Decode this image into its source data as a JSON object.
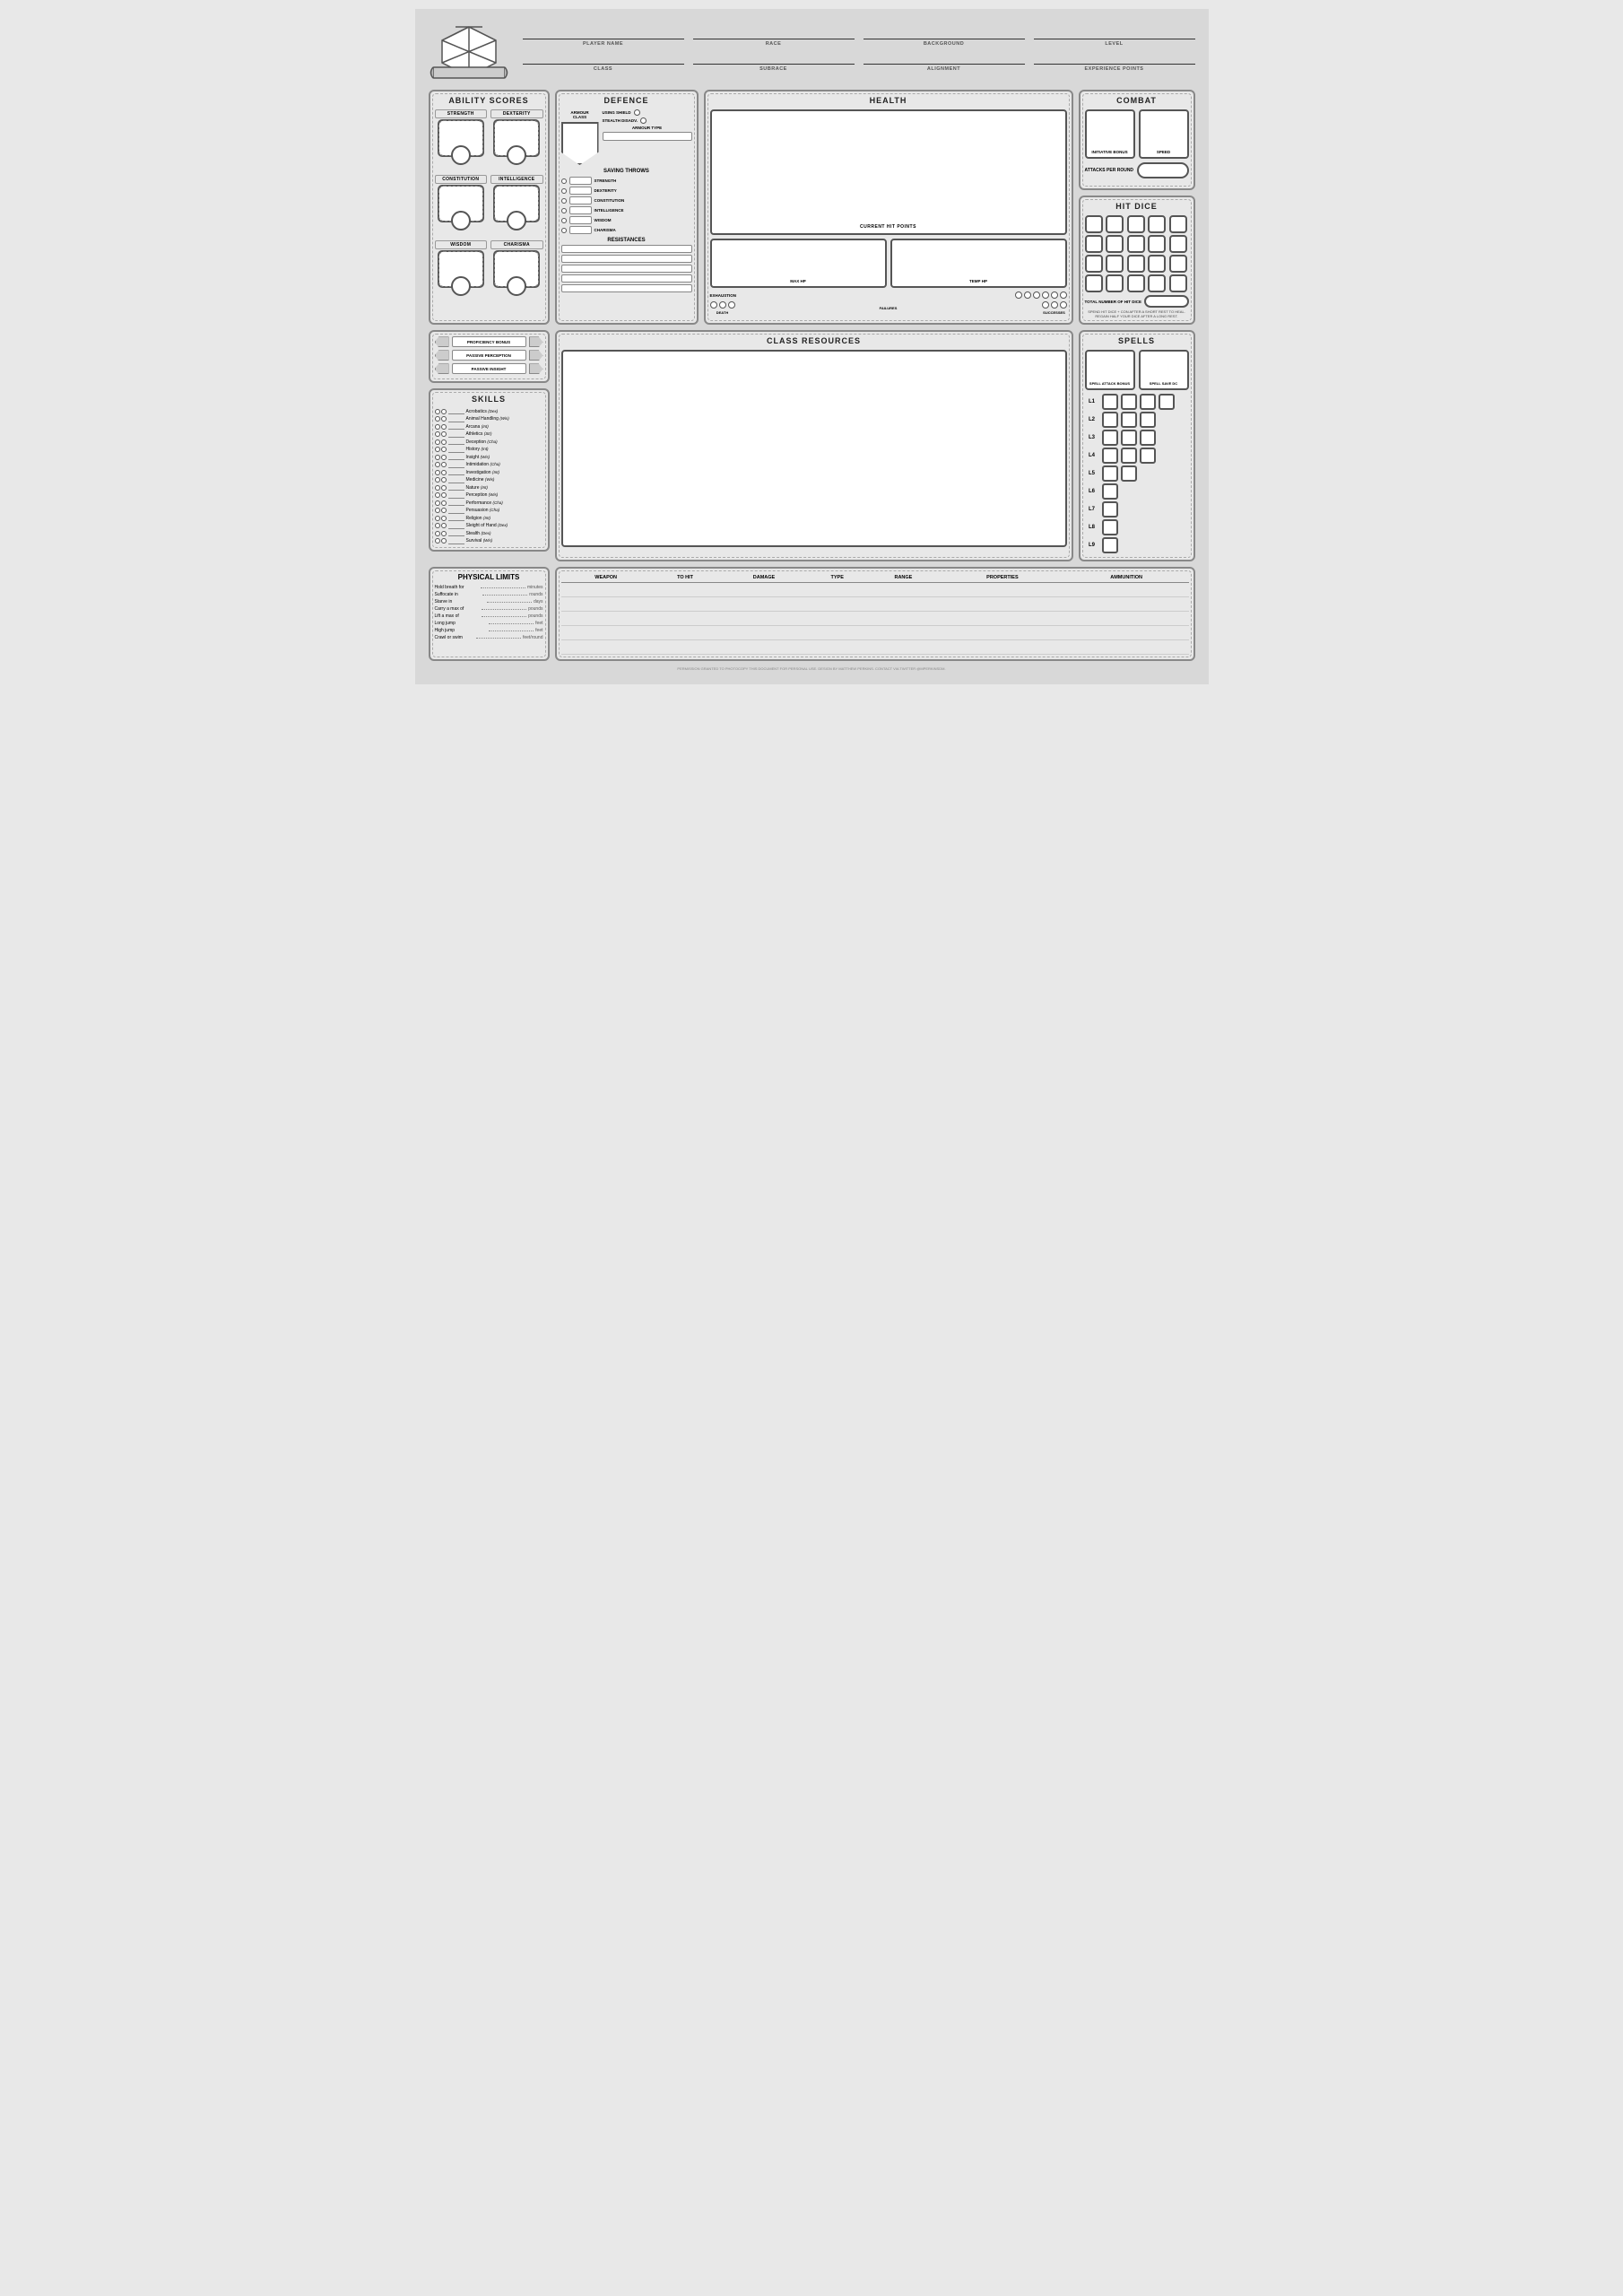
{
  "header": {
    "player_name_label": "PLAYER NAME",
    "race_label": "RACE",
    "background_label": "BACKGROUND",
    "level_label": "LEVEL",
    "class_label": "CLASS",
    "subrace_label": "SUBRACE",
    "alignment_label": "ALIGNMENT",
    "experience_label": "EXPERIENCE POINTS"
  },
  "ability_scores": {
    "title": "ABILITY SCORES",
    "scores": [
      {
        "label": "STRENGTH"
      },
      {
        "label": "DEXTERITY"
      },
      {
        "label": "CONSTITUTION"
      },
      {
        "label": "INTELLIGENCE"
      },
      {
        "label": "WISDOM"
      },
      {
        "label": "CHARISMA"
      }
    ]
  },
  "defence": {
    "title": "DEFENCE",
    "armour_class_label": "ARMOUR CLASS",
    "using_shield_label": "USING SHIELD",
    "stealth_disadv_label": "STEALTH DISADV.",
    "armour_type_label": "ARMOUR TYPE",
    "saving_throws_title": "SAVING THROWS",
    "saves": [
      {
        "label": "STRENGTH"
      },
      {
        "label": "DEXTERITY"
      },
      {
        "label": "CONSTITUTION"
      },
      {
        "label": "INTELLIGENCE"
      },
      {
        "label": "WISDOM"
      },
      {
        "label": "CHARISMA"
      }
    ],
    "resistances_title": "RESISTANCES"
  },
  "health": {
    "title": "HEALTH",
    "current_hp_label": "CURRENT HIT POINTS",
    "max_hp_label": "MAX HP",
    "temp_hp_label": "TEMP HP",
    "exhaustion_label": "EXHAUSTION",
    "death_label": "DEATH",
    "failures_label": "FAILURES",
    "successes_label": "SUCCESSES"
  },
  "combat": {
    "title": "COMBAT",
    "initiative_label": "INITIATIVE BONUS",
    "speed_label": "SPEED",
    "attacks_label": "ATTACKS PER ROUND"
  },
  "hit_dice": {
    "title": "HIT DICE",
    "total_label": "TOTAL NUMBER OF HIT DICE",
    "note": "SPEND HIT DICE + CON AFTER A SHORT REST TO HEAL. REGAIN HALF YOUR DICE AFTER A LONG REST."
  },
  "bonuses": {
    "proficiency_label": "PROFICIENCY BONUS",
    "perception_label": "PASSIVE PERCEPTION",
    "insight_label": "PASSIVE INSIGHT"
  },
  "skills": {
    "title": "SKILLS",
    "list": [
      {
        "name": "Acrobatics",
        "stat": "Dex"
      },
      {
        "name": "Animal Handling",
        "stat": "Wis"
      },
      {
        "name": "Arcana",
        "stat": "Int"
      },
      {
        "name": "Athletics",
        "stat": "Str"
      },
      {
        "name": "Deception",
        "stat": "Cha"
      },
      {
        "name": "History",
        "stat": "Int"
      },
      {
        "name": "Insight",
        "stat": "Wis"
      },
      {
        "name": "Intimidation",
        "stat": "Cha"
      },
      {
        "name": "Investigation",
        "stat": "Int"
      },
      {
        "name": "Medicine",
        "stat": "Wis"
      },
      {
        "name": "Nature",
        "stat": "Int"
      },
      {
        "name": "Perception",
        "stat": "Wis"
      },
      {
        "name": "Performance",
        "stat": "Cha"
      },
      {
        "name": "Persuasion",
        "stat": "Cha"
      },
      {
        "name": "Religion",
        "stat": "Int"
      },
      {
        "name": "Sleight of Hand",
        "stat": "Dex"
      },
      {
        "name": "Stealth",
        "stat": "Dex"
      },
      {
        "name": "Survival",
        "stat": "Wis"
      }
    ]
  },
  "class_resources": {
    "title": "CLASS RESOURCES"
  },
  "spells": {
    "title": "SPELLS",
    "attack_label": "SPELL ATTACK BONUS",
    "save_label": "SPELL SAVE DC",
    "levels": [
      "L1",
      "L2",
      "L3",
      "L4",
      "L5",
      "L6",
      "L7",
      "L8",
      "L9"
    ],
    "slots": [
      4,
      3,
      3,
      3,
      2,
      1,
      1,
      1,
      1
    ]
  },
  "physical": {
    "title": "PHYSICAL LIMITS",
    "rows": [
      {
        "label": "Hold breath for",
        "unit": "minutes"
      },
      {
        "label": "Suffocate in",
        "unit": "rounds"
      },
      {
        "label": "Starve in",
        "unit": "days"
      },
      {
        "label": "Carry a max of",
        "unit": "pounds"
      },
      {
        "label": "Lift a max of",
        "unit": "pounds"
      },
      {
        "label": "Long jump",
        "unit": "feet"
      },
      {
        "label": "High jump",
        "unit": "feet"
      },
      {
        "label": "Crawl or swim",
        "unit": "feet/round"
      }
    ]
  },
  "weapons": {
    "headers": [
      "WEAPON",
      "TO HIT",
      "DAMAGE",
      "TYPE",
      "RANGE",
      "PROPERTIES",
      "AMMUNITION"
    ],
    "rows": 5
  },
  "footer": {
    "text": "PERMISSION GRANTED TO PHOTOCOPY THIS DOCUMENT FOR PERSONAL USE. DESIGN BY MATTHEW PERKINS. CONTACT VIA TWITTER @MPERKINSDM."
  }
}
